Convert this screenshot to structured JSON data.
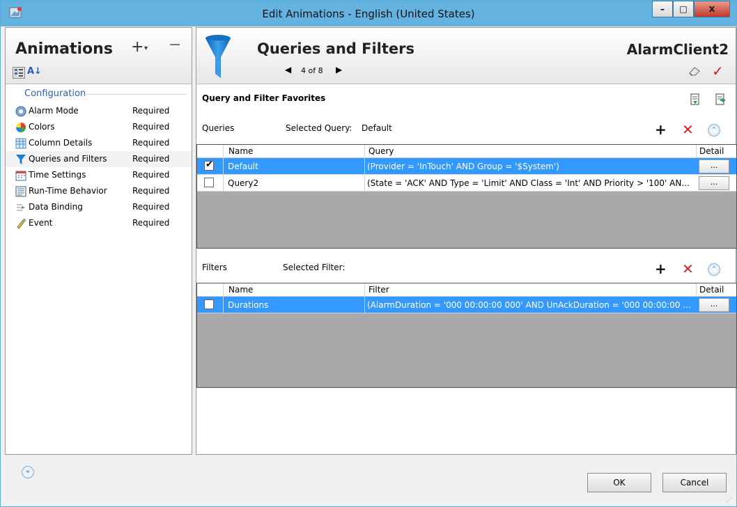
{
  "window": {
    "title": "Edit Animations - English (United States)",
    "min_label": "–",
    "max_label": "□",
    "close_label": "x"
  },
  "left": {
    "title": "Animations",
    "add_label": "+",
    "add_arrow": "▾",
    "remove_label": "−",
    "sort_label": "A↓",
    "category": "Configuration",
    "items": [
      {
        "label": "Alarm Mode",
        "status": "Required",
        "icon": "alarm-mode-icon"
      },
      {
        "label": "Colors",
        "status": "Required",
        "icon": "colors-icon"
      },
      {
        "label": "Column Details",
        "status": "Required",
        "icon": "column-details-icon"
      },
      {
        "label": "Queries and Filters",
        "status": "Required",
        "icon": "funnel-icon"
      },
      {
        "label": "Time Settings",
        "status": "Required",
        "icon": "time-settings-icon"
      },
      {
        "label": "Run-Time Behavior",
        "status": "Required",
        "icon": "runtime-behavior-icon"
      },
      {
        "label": "Data Binding",
        "status": "Required",
        "icon": "data-binding-icon"
      },
      {
        "label": "Event",
        "status": "Required",
        "icon": "event-icon"
      }
    ]
  },
  "right": {
    "title": "Queries and Filters",
    "page_indicator": "4 of 8",
    "prev_label": "◀",
    "next_label": "▶",
    "object_name": "AlarmClient2",
    "favorites_title": "Query and Filter Favorites",
    "queries": {
      "label": "Queries",
      "selected_label": "Selected Query:",
      "selected_value": "Default",
      "columns": [
        "Name",
        "Query",
        "Detail"
      ],
      "rows": [
        {
          "checked": true,
          "name": "Default",
          "query": "(Provider = 'InTouch' AND Group = '$System')",
          "detail": "..."
        },
        {
          "checked": false,
          "name": "Query2",
          "query": "(State = 'ACK' AND Type = 'Limit' AND Class = 'Int' AND Priority > '100' AN...",
          "detail": "..."
        }
      ]
    },
    "filters": {
      "label": "Filters",
      "selected_label": "Selected Filter:",
      "selected_value": "",
      "columns": [
        "Name",
        "Filter",
        "Detail"
      ],
      "rows": [
        {
          "checked": false,
          "name": "Durations",
          "filter": "(AlarmDuration = '000 00:00:00 000' AND UnAckDuration = '000 00:00:00 ...",
          "detail": "..."
        }
      ]
    },
    "toolbar": {
      "add": "+",
      "delete": "✕",
      "collapse": "⌃"
    }
  },
  "footer": {
    "ok_label": "OK",
    "cancel_label": "Cancel",
    "collapse_label": "«"
  },
  "colors": {
    "titlebar": "#63b2e0",
    "selection": "#3399ff",
    "delete": "#e01b1b",
    "accent": "#2e5ea8"
  }
}
